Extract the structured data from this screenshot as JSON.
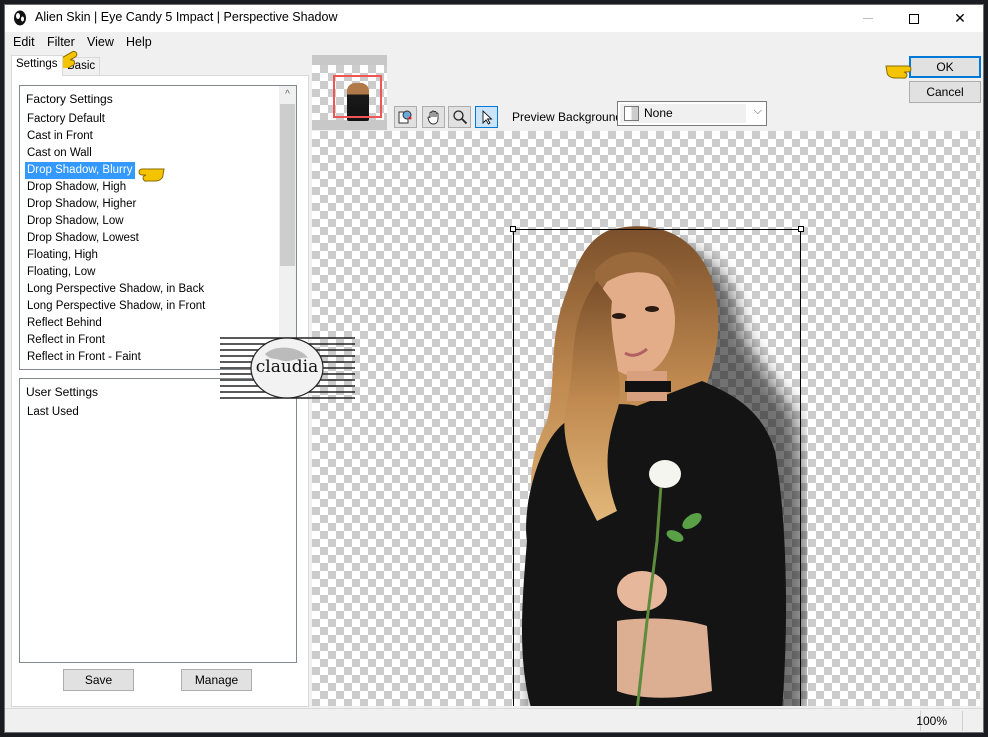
{
  "window": {
    "title": "Alien Skin | Eye Candy 5 Impact | Perspective Shadow",
    "minimize_label": "—",
    "maximize_label": "",
    "close_label": "✕"
  },
  "menu": [
    "Edit",
    "Filter",
    "View",
    "Help"
  ],
  "tabs": [
    {
      "label": "Settings",
      "active": true
    },
    {
      "label": "Basic",
      "active": false
    }
  ],
  "factory_settings": {
    "header": "Factory Settings",
    "items": [
      "Factory Default",
      "Cast in Front",
      "Cast on Wall",
      "Drop Shadow, Blurry",
      "Drop Shadow, High",
      "Drop Shadow, Higher",
      "Drop Shadow, Low",
      "Drop Shadow, Lowest",
      "Floating, High",
      "Floating, Low",
      "Long Perspective Shadow, in Back",
      "Long Perspective Shadow, in Front",
      "Reflect Behind",
      "Reflect in Front",
      "Reflect in Front - Faint"
    ],
    "selected": "Drop Shadow, Blurry",
    "scroll_up_icon": "^"
  },
  "user_settings": {
    "header": "User Settings",
    "items": [
      "Last Used"
    ]
  },
  "buttons": {
    "save": "Save",
    "manage": "Manage",
    "ok": "OK",
    "cancel": "Cancel"
  },
  "toolbar": {
    "tools": [
      {
        "name": "preview-compare-icon",
        "glyph": "⧉",
        "active": false
      },
      {
        "name": "hand-pan-icon",
        "glyph": "✋",
        "active": false
      },
      {
        "name": "zoom-magnifier-icon",
        "glyph": "🔍",
        "active": false
      },
      {
        "name": "arrow-select-icon",
        "glyph": "↖",
        "active": true
      }
    ],
    "preview_background_label": "Preview Background:",
    "preview_background_value": "None",
    "chevron": "⌵"
  },
  "status": {
    "zoom": "100%"
  },
  "watermark_text": "claudia",
  "colors": {
    "selection": "#3399ff",
    "ok_border": "#0078d7",
    "thumb_frame": "#f05555",
    "pointer_yellow": "#f5c400"
  }
}
